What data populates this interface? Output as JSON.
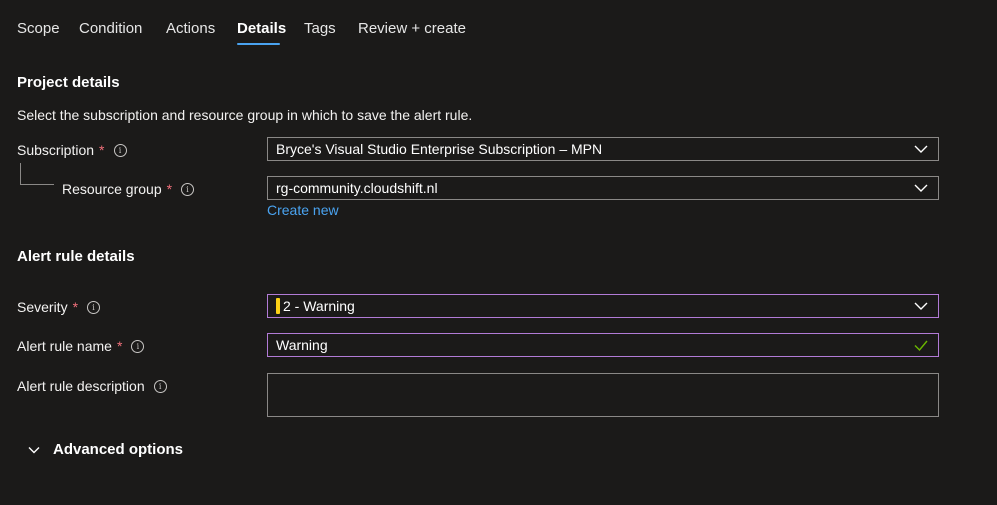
{
  "tabs": [
    {
      "label": "Scope"
    },
    {
      "label": "Condition"
    },
    {
      "label": "Actions"
    },
    {
      "label": "Details",
      "active": true
    },
    {
      "label": "Tags"
    },
    {
      "label": "Review + create"
    }
  ],
  "project": {
    "title": "Project details",
    "description": "Select the subscription and resource group in which to save the alert rule.",
    "subscription_label": "Subscription",
    "subscription_value": "Bryce's Visual Studio Enterprise Subscription – MPN",
    "resource_group_label": "Resource group",
    "resource_group_value": "rg-community.cloudshift.nl",
    "create_new": "Create new"
  },
  "alert": {
    "title": "Alert rule details",
    "severity_label": "Severity",
    "severity_value": "2 - Warning",
    "severity_color": "#fcd116",
    "name_label": "Alert rule name",
    "name_value": "Warning",
    "description_label": "Alert rule description",
    "description_value": ""
  },
  "advanced_options": "Advanced options",
  "required_mark": "*",
  "info_glyph": "i",
  "colors": {
    "accent": "#4aa3f0",
    "focus_border": "#b27bd6",
    "required": "#f1707b",
    "valid": "#6bb700",
    "background": "#1b1a19"
  }
}
